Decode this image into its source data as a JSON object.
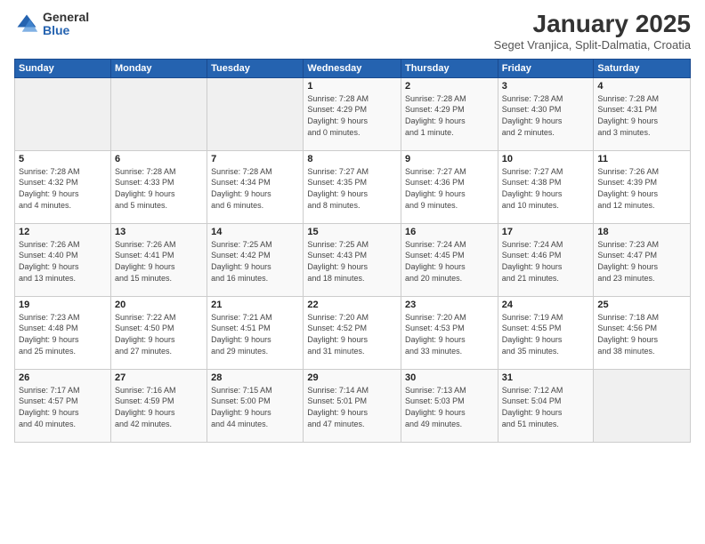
{
  "header": {
    "logo_general": "General",
    "logo_blue": "Blue",
    "month_title": "January 2025",
    "subtitle": "Seget Vranjica, Split-Dalmatia, Croatia"
  },
  "days_of_week": [
    "Sunday",
    "Monday",
    "Tuesday",
    "Wednesday",
    "Thursday",
    "Friday",
    "Saturday"
  ],
  "weeks": [
    [
      {
        "num": "",
        "info": ""
      },
      {
        "num": "",
        "info": ""
      },
      {
        "num": "",
        "info": ""
      },
      {
        "num": "1",
        "info": "Sunrise: 7:28 AM\nSunset: 4:29 PM\nDaylight: 9 hours\nand 0 minutes."
      },
      {
        "num": "2",
        "info": "Sunrise: 7:28 AM\nSunset: 4:29 PM\nDaylight: 9 hours\nand 1 minute."
      },
      {
        "num": "3",
        "info": "Sunrise: 7:28 AM\nSunset: 4:30 PM\nDaylight: 9 hours\nand 2 minutes."
      },
      {
        "num": "4",
        "info": "Sunrise: 7:28 AM\nSunset: 4:31 PM\nDaylight: 9 hours\nand 3 minutes."
      }
    ],
    [
      {
        "num": "5",
        "info": "Sunrise: 7:28 AM\nSunset: 4:32 PM\nDaylight: 9 hours\nand 4 minutes."
      },
      {
        "num": "6",
        "info": "Sunrise: 7:28 AM\nSunset: 4:33 PM\nDaylight: 9 hours\nand 5 minutes."
      },
      {
        "num": "7",
        "info": "Sunrise: 7:28 AM\nSunset: 4:34 PM\nDaylight: 9 hours\nand 6 minutes."
      },
      {
        "num": "8",
        "info": "Sunrise: 7:27 AM\nSunset: 4:35 PM\nDaylight: 9 hours\nand 8 minutes."
      },
      {
        "num": "9",
        "info": "Sunrise: 7:27 AM\nSunset: 4:36 PM\nDaylight: 9 hours\nand 9 minutes."
      },
      {
        "num": "10",
        "info": "Sunrise: 7:27 AM\nSunset: 4:38 PM\nDaylight: 9 hours\nand 10 minutes."
      },
      {
        "num": "11",
        "info": "Sunrise: 7:26 AM\nSunset: 4:39 PM\nDaylight: 9 hours\nand 12 minutes."
      }
    ],
    [
      {
        "num": "12",
        "info": "Sunrise: 7:26 AM\nSunset: 4:40 PM\nDaylight: 9 hours\nand 13 minutes."
      },
      {
        "num": "13",
        "info": "Sunrise: 7:26 AM\nSunset: 4:41 PM\nDaylight: 9 hours\nand 15 minutes."
      },
      {
        "num": "14",
        "info": "Sunrise: 7:25 AM\nSunset: 4:42 PM\nDaylight: 9 hours\nand 16 minutes."
      },
      {
        "num": "15",
        "info": "Sunrise: 7:25 AM\nSunset: 4:43 PM\nDaylight: 9 hours\nand 18 minutes."
      },
      {
        "num": "16",
        "info": "Sunrise: 7:24 AM\nSunset: 4:45 PM\nDaylight: 9 hours\nand 20 minutes."
      },
      {
        "num": "17",
        "info": "Sunrise: 7:24 AM\nSunset: 4:46 PM\nDaylight: 9 hours\nand 21 minutes."
      },
      {
        "num": "18",
        "info": "Sunrise: 7:23 AM\nSunset: 4:47 PM\nDaylight: 9 hours\nand 23 minutes."
      }
    ],
    [
      {
        "num": "19",
        "info": "Sunrise: 7:23 AM\nSunset: 4:48 PM\nDaylight: 9 hours\nand 25 minutes."
      },
      {
        "num": "20",
        "info": "Sunrise: 7:22 AM\nSunset: 4:50 PM\nDaylight: 9 hours\nand 27 minutes."
      },
      {
        "num": "21",
        "info": "Sunrise: 7:21 AM\nSunset: 4:51 PM\nDaylight: 9 hours\nand 29 minutes."
      },
      {
        "num": "22",
        "info": "Sunrise: 7:20 AM\nSunset: 4:52 PM\nDaylight: 9 hours\nand 31 minutes."
      },
      {
        "num": "23",
        "info": "Sunrise: 7:20 AM\nSunset: 4:53 PM\nDaylight: 9 hours\nand 33 minutes."
      },
      {
        "num": "24",
        "info": "Sunrise: 7:19 AM\nSunset: 4:55 PM\nDaylight: 9 hours\nand 35 minutes."
      },
      {
        "num": "25",
        "info": "Sunrise: 7:18 AM\nSunset: 4:56 PM\nDaylight: 9 hours\nand 38 minutes."
      }
    ],
    [
      {
        "num": "26",
        "info": "Sunrise: 7:17 AM\nSunset: 4:57 PM\nDaylight: 9 hours\nand 40 minutes."
      },
      {
        "num": "27",
        "info": "Sunrise: 7:16 AM\nSunset: 4:59 PM\nDaylight: 9 hours\nand 42 minutes."
      },
      {
        "num": "28",
        "info": "Sunrise: 7:15 AM\nSunset: 5:00 PM\nDaylight: 9 hours\nand 44 minutes."
      },
      {
        "num": "29",
        "info": "Sunrise: 7:14 AM\nSunset: 5:01 PM\nDaylight: 9 hours\nand 47 minutes."
      },
      {
        "num": "30",
        "info": "Sunrise: 7:13 AM\nSunset: 5:03 PM\nDaylight: 9 hours\nand 49 minutes."
      },
      {
        "num": "31",
        "info": "Sunrise: 7:12 AM\nSunset: 5:04 PM\nDaylight: 9 hours\nand 51 minutes."
      },
      {
        "num": "",
        "info": ""
      }
    ]
  ]
}
